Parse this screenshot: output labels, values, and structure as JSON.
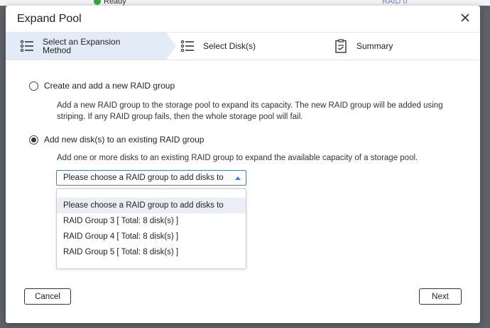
{
  "background": {
    "status_text": "Ready",
    "raid_text": "RAID 0"
  },
  "dialog": {
    "title": "Expand Pool"
  },
  "steps": [
    {
      "label": "Select an Expansion Method",
      "icon": "list-icon"
    },
    {
      "label": "Select Disk(s)",
      "icon": "list-icon"
    },
    {
      "label": "Summary",
      "icon": "clipboard-icon"
    }
  ],
  "options": {
    "create_new": {
      "label": "Create and add a new RAID group",
      "description": "Add a new RAID group to the storage pool to expand its capacity. The new RAID group will be added using striping. If any RAID group fails, then the whole storage pool will fail.",
      "checked": false
    },
    "add_existing": {
      "label": "Add new disk(s) to an existing RAID group",
      "description": "Add one or more disks to an existing RAID group to expand the available capacity of a storage pool.",
      "checked": true
    }
  },
  "select": {
    "value": "Please choose a RAID group to add disks to",
    "options": [
      "Please choose a RAID group to add disks to",
      "RAID Group 3 [ Total: 8 disk(s) ]",
      "RAID Group 4 [ Total: 8 disk(s) ]",
      "RAID Group 5 [ Total: 8 disk(s) ]"
    ]
  },
  "buttons": {
    "cancel": "Cancel",
    "next": "Next"
  },
  "colors": {
    "accent": "#4a7ad8",
    "step_active_bg": "#e4ebf8",
    "status_green": "#3aa34a"
  }
}
